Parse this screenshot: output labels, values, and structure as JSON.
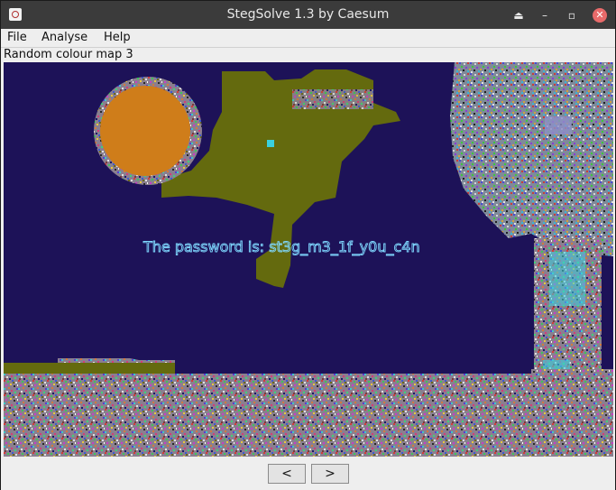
{
  "window": {
    "title": "StegSolve 1.3 by Caesum",
    "buttons": {
      "eject": "⏏",
      "minimize": "–",
      "maximize": "▫",
      "close": "✕"
    }
  },
  "menu": {
    "items": [
      {
        "label": "File"
      },
      {
        "label": "Analyse"
      },
      {
        "label": "Help"
      }
    ]
  },
  "viewer": {
    "mode_label": "Random colour map 3",
    "hidden_message": "The password is: st3g_m3_1f_y0u_c4n"
  },
  "navigation": {
    "prev_label": "<",
    "next_label": ">"
  },
  "colors": {
    "titlebar": "#3b3b3b",
    "image_background": "#1d1258",
    "land": "#646a0e",
    "sun": "#cf7d1a",
    "message_text": "#7fd8ff"
  }
}
